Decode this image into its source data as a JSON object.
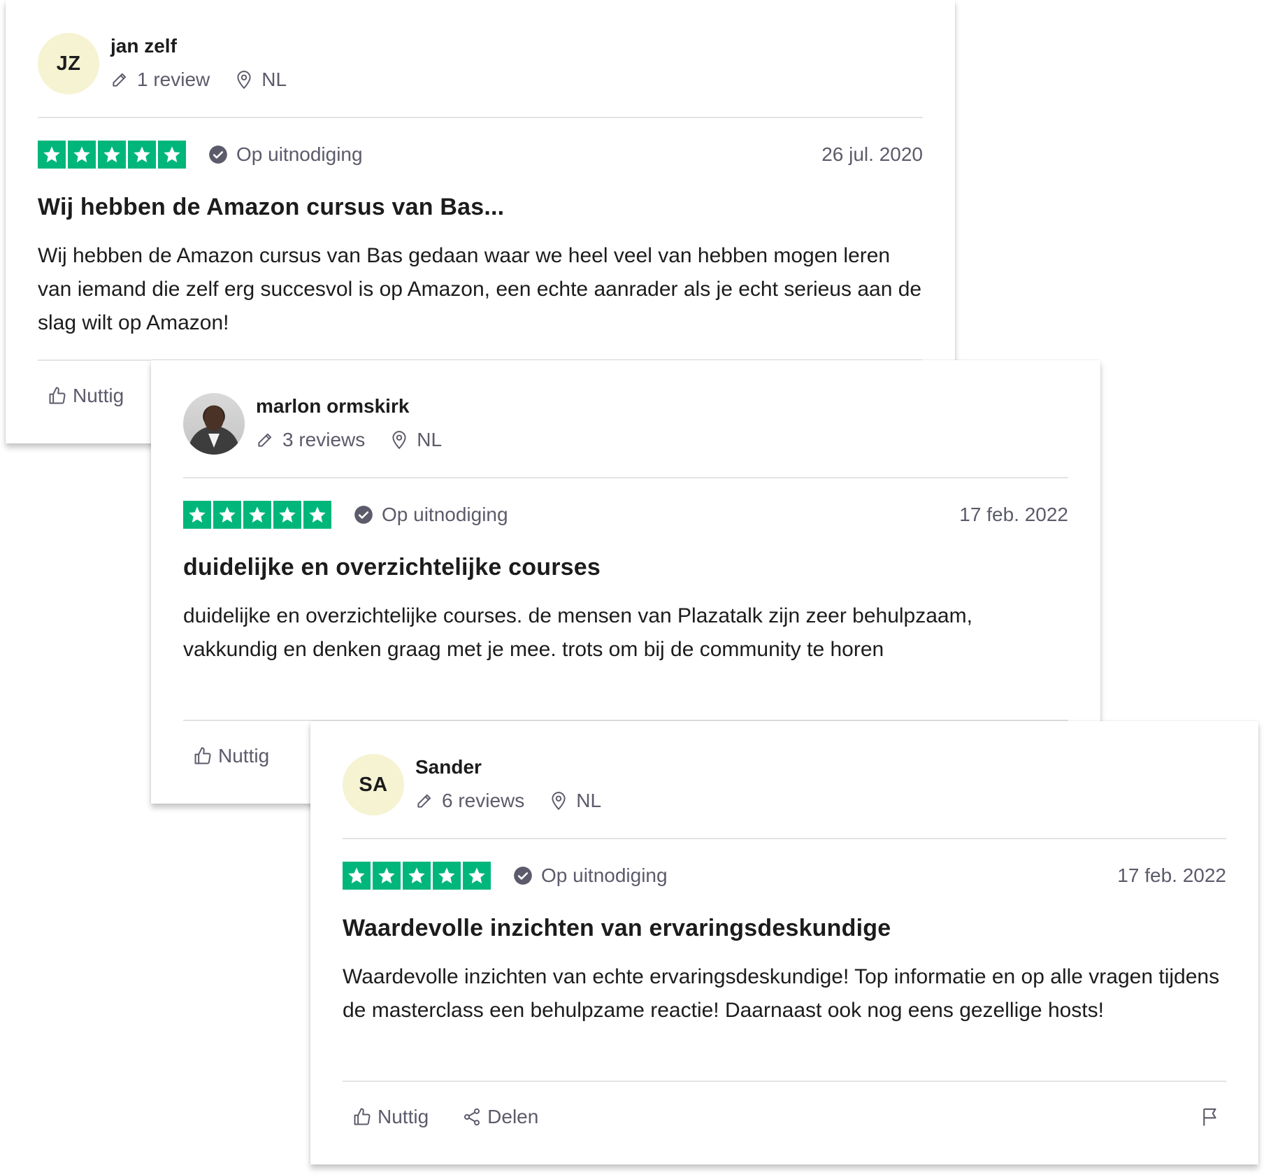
{
  "reviews": [
    {
      "avatar_initials": "JZ",
      "avatar_type": "initials",
      "name": "jan zelf",
      "review_count": "1 review",
      "country": "NL",
      "rating": 5,
      "verification": "Op uitnodiging",
      "date": "26 jul. 2020",
      "title": "Wij hebben de Amazon cursus van Bas...",
      "body": "Wij hebben de Amazon cursus van Bas gedaan waar we heel veel van hebben mogen leren van iemand die zelf erg succesvol is op Amazon, een echte aanrader als je echt serieus aan de slag wilt op Amazon!",
      "helpful_label": "Nuttig"
    },
    {
      "avatar_initials": "",
      "avatar_type": "photo",
      "name": "marlon ormskirk",
      "review_count": "3 reviews",
      "country": "NL",
      "rating": 5,
      "verification": "Op uitnodiging",
      "date": "17 feb. 2022",
      "title": "duidelijke en overzichtelijke courses",
      "body": "duidelijke en overzichtelijke courses. de mensen van Plazatalk zijn zeer behulpzaam, vakkundig en denken graag met je mee. trots om bij de community te horen",
      "helpful_label": "Nuttig"
    },
    {
      "avatar_initials": "SA",
      "avatar_type": "initials",
      "name": "Sander",
      "review_count": "6 reviews",
      "country": "NL",
      "rating": 5,
      "verification": "Op uitnodiging",
      "date": "17 feb. 2022",
      "title": "Waardevolle inzichten van ervaringsdeskundige",
      "body": "Waardevolle inzichten van echte ervaringsdeskundige! Top informatie en op alle vragen tijdens de masterclass een behulpzame reactie! Daarnaast ook nog eens gezellige hosts!",
      "helpful_label": "Nuttig",
      "share_label": "Delen"
    }
  ],
  "colors": {
    "star_green": "#00b67a",
    "avatar_bg": "#f6f3d3",
    "muted_text": "#5b5b6b",
    "divider": "#e3e3e6"
  },
  "icons": [
    "pencil-icon",
    "location-pin-icon",
    "star-icon",
    "verified-check-icon",
    "thumbs-up-icon",
    "share-icon",
    "flag-icon"
  ]
}
